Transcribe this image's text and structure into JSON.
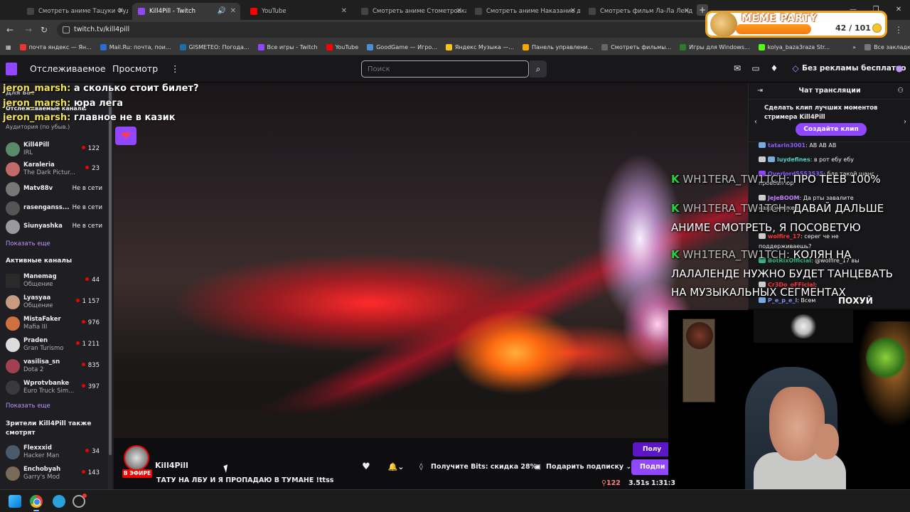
{
  "browser": {
    "tabs": [
      {
        "title": "Смотреть аниме Тацуки Фудзи",
        "active": false
      },
      {
        "title": "Kill4Pill - Twitch",
        "active": true
      },
      {
        "title": "YouTube",
        "active": false
      },
      {
        "title": "Смотреть аниме Стометровка",
        "active": false
      },
      {
        "title": "Смотреть аниме Наказание д",
        "active": false
      },
      {
        "title": "Смотреть фильм Ла-Ла Ленд",
        "active": false
      }
    ],
    "url": "twitch.tv/kill4pill",
    "bookmarks": [
      "почта яндекс — Ян...",
      "Mail.Ru: почта, пои...",
      "GISMETEO: Погода...",
      "Все игры - Twitch",
      "YouTube",
      "GoodGame — Игро...",
      "Яндекс Музыка —...",
      "Панель управлени...",
      "Смотреть фильмы...",
      "Игры для Windows...",
      "kolya_baza3raza Str..."
    ],
    "all_bookmarks": "Все закладки"
  },
  "meme_widget": {
    "title": "MEME PARTY",
    "count": "42 / 101",
    "progress": 0.42
  },
  "twitch_nav": {
    "following": "Отслеживаемое",
    "browse": "Просмотр",
    "more": "⋮",
    "search_placeholder": "Поиск",
    "no_ads": "Без рекламы бесплатно"
  },
  "sidebar": {
    "header_for_you": "Для вас",
    "followed_label": "Отслеживаемые каналы",
    "audience_label": "Аудитория (по убыв.)",
    "followed": [
      {
        "name": "Kill4Pill",
        "game": "IRL",
        "viewers": "122",
        "color": "#5a8a6a"
      },
      {
        "name": "Karaleria",
        "game": "The Dark Pictur...",
        "viewers": "23",
        "color": "#c06a6a"
      },
      {
        "name": "Matv88v",
        "status": "Не в сети",
        "color": "#777777"
      },
      {
        "name": "rasenganss...",
        "status": "Не в сети",
        "color": "#555555"
      },
      {
        "name": "Siunyashka",
        "status": "Не в сети",
        "color": "#9a9a9a"
      }
    ],
    "show_more": "Показать еще",
    "active_label": "Активные каналы",
    "active": [
      {
        "name": "Manemag",
        "game": "Общение",
        "viewers": "44",
        "color": "#2a2a2a"
      },
      {
        "name": "Lyasyaa",
        "game": "Общение",
        "viewers": "1 157",
        "color": "#c89a80"
      },
      {
        "name": "MistaFaker",
        "game": "Mafia III",
        "viewers": "976",
        "color": "#d07040"
      },
      {
        "name": "Praden",
        "game": "Gran Turismo",
        "viewers": "1 211",
        "color": "#dddddd"
      },
      {
        "name": "vasilisa_sn",
        "game": "Dota 2",
        "viewers": "835",
        "color": "#a04050"
      },
      {
        "name": "Wprotvbanke",
        "game": "Euro Truck Sim...",
        "viewers": "397",
        "color": "#3a3a3a"
      }
    ],
    "show_more_2": "Показать еще",
    "also_watch": "Зрители Kill4Pill также смотрят",
    "also": [
      {
        "name": "Flexxxid",
        "game": "Hacker Man",
        "viewers": "34",
        "color": "#4a5a6a"
      },
      {
        "name": "Enchobyah",
        "game": "Garry's Mod",
        "viewers": "143",
        "color": "#7a6a5a"
      }
    ]
  },
  "overlay_chat": [
    {
      "user": "jeron_marsh:",
      "text": " а сколько стоит билет?"
    },
    {
      "user": "jeron_marsh:",
      "text": " юра лега"
    },
    {
      "user": "jeron_marsh:",
      "text": " главное не в казик"
    }
  ],
  "overlay_right": [
    {
      "user": "WH1TERA_TW1TCH:",
      "text": " ПРО ТЕЕВ 100%"
    },
    {
      "user": "WH1TERA_TW1TCH:",
      "text": " ДАВАЙ ДАЛЬШЕ"
    },
    {
      "line": "АНИМЕ СМОТРЕТЬ, Я ПОСОВЕТУЮ"
    },
    {
      "user": "WH1TERA_TW1TCH:",
      "text": " КОЛЯН НА"
    },
    {
      "line": "ЛАЛАЛЕНДЕ НУЖНО БУДЕТ ТАНЦЕВАТЬ"
    },
    {
      "line": "НА МУЗЫКАЛЬНЫХ СЕГМЕНТАХ"
    }
  ],
  "chat": {
    "title": "Чат трансляции",
    "clip_prompt": "Сделать клип лучших моментов стримера Kill4Pill",
    "clip_button": "Создайте клип",
    "messages": [
      {
        "user": "tatarin3001",
        "text": ": АВ АВ АВ",
        "color": "#8a5cf6"
      },
      {
        "user": "luydefines",
        "text": ": в рот ебу ебу",
        "color": "#4fd1c5"
      },
      {
        "user": "Overlord5553535",
        "text": ": бля такой шанс",
        "color": "#8a5cf6"
      },
      {
        "user": "",
        "text": "проебал юр",
        "color": "#efeff1"
      },
      {
        "user": "JeJeBOOM",
        "text": ": Да рты завалите",
        "color": "#c080ff"
      },
      {
        "user": "",
        "text": "нахромаркер",
        "color": "#efeff1"
      },
      {
        "user": "wolfire_17",
        "text": ": серег че не",
        "color": "#ff3030"
      },
      {
        "user": "",
        "text": "поддерживаешь?",
        "color": "#efeff1"
      },
      {
        "user": "BotRixOfficial",
        "text": ": @wolfire_17 вы",
        "color": "#36b37e"
      },
      {
        "user": "Cr3Do_oFFicial",
        "text": ":",
        "color": "#ff3030"
      },
      {
        "user": "P_e_p_e_l",
        "text": ": Всем",
        "color": "#8a8aff"
      }
    ],
    "overlay_word": "ПОХУЙ"
  },
  "stream": {
    "streamer": "Kill4Pill",
    "live_label": "В ЭФИРЕ",
    "title": "ТАТУ НА ЛБУ И Я ПРОПАДАЮ В ТУМАНЕ !ttss",
    "get_bits": "Получите Bits: скидка 28%",
    "gift_sub": "Подарить подписку",
    "get_btn": "Полу",
    "sub_btn": "Подпи",
    "viewers": "122",
    "ratio": "3.51s",
    "uptime": "1:31:3"
  }
}
